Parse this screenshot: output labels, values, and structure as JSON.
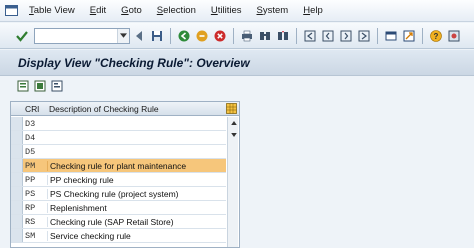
{
  "menu": {
    "items": [
      {
        "label": "Table View",
        "accel": "T",
        "rest": "able View"
      },
      {
        "label": "Edit",
        "accel": "E",
        "rest": "dit"
      },
      {
        "label": "Goto",
        "accel": "G",
        "rest": "oto"
      },
      {
        "label": "Selection",
        "accel": "S",
        "rest": "election"
      },
      {
        "label": "Utilities",
        "accel": "U",
        "rest": "tilities"
      },
      {
        "label": "System",
        "accel": "S",
        "rest": "ystem"
      },
      {
        "label": "Help",
        "accel": "H",
        "rest": "elp"
      }
    ]
  },
  "toolbar": {
    "command_value": ""
  },
  "title": "Display View \"Checking Rule\": Overview",
  "table": {
    "col_code": "CRl",
    "col_desc": "Description of Checking Rule",
    "rows": [
      {
        "code": "D3",
        "desc": ""
      },
      {
        "code": "D4",
        "desc": ""
      },
      {
        "code": "D5",
        "desc": ""
      },
      {
        "code": "PM",
        "desc": "Checking rule for plant maintenance"
      },
      {
        "code": "PP",
        "desc": "PP checking rule"
      },
      {
        "code": "PS",
        "desc": "PS Checking rule (project system)"
      },
      {
        "code": "RP",
        "desc": "Replenishment"
      },
      {
        "code": "RS",
        "desc": "Checking rule (SAP Retail Store)"
      },
      {
        "code": "SM",
        "desc": "Service checking rule"
      }
    ],
    "highlight_index": 3
  },
  "colors": {
    "highlight": "#f6c67b",
    "background": "#eef3f8",
    "title_text": "#0a1a33"
  }
}
